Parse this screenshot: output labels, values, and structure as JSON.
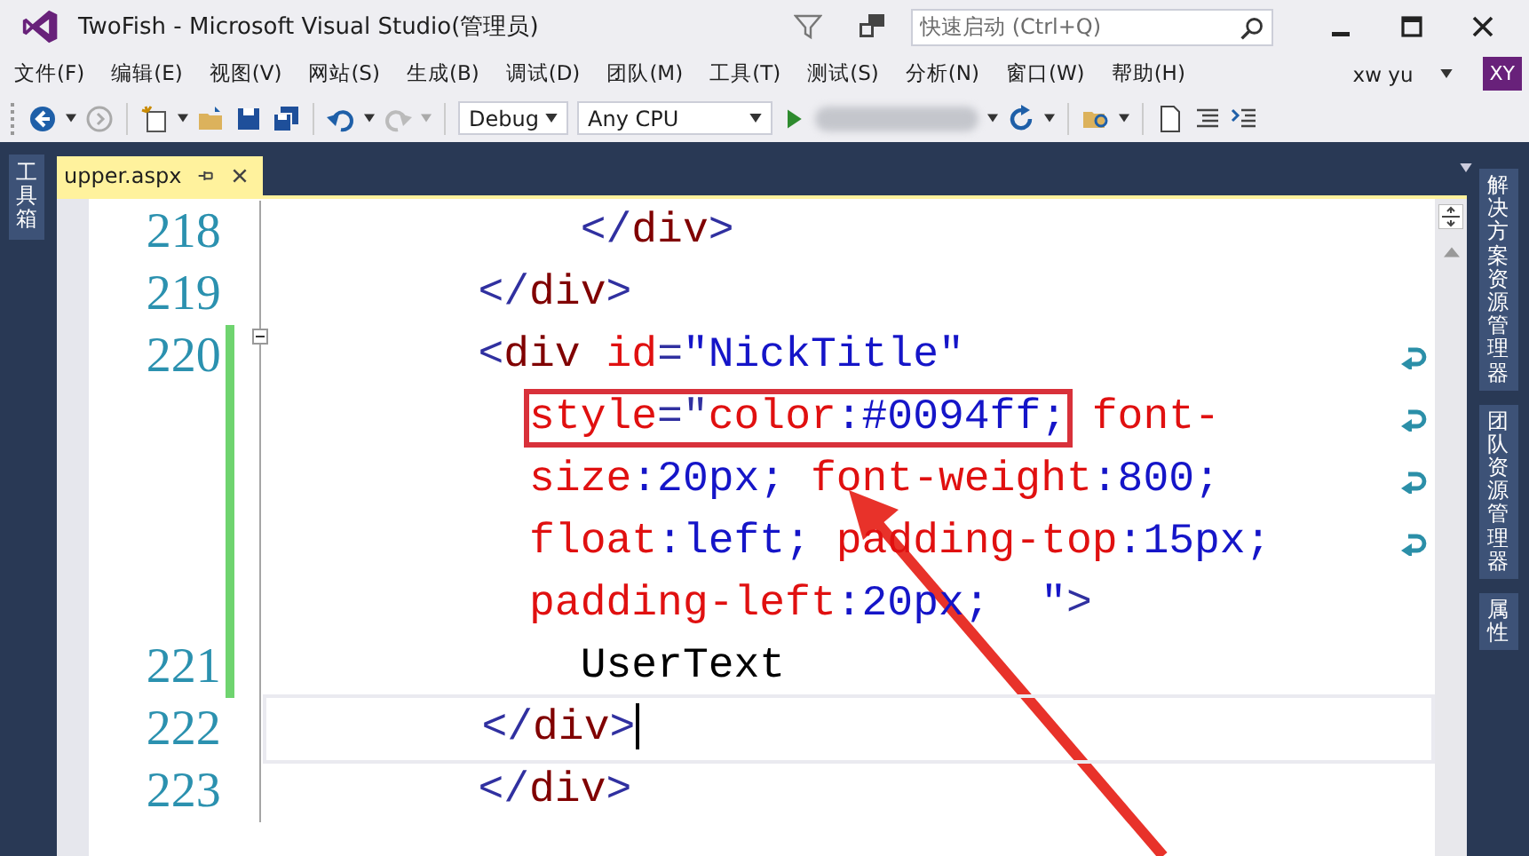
{
  "window": {
    "title": "TwoFish - Microsoft Visual Studio(管理员)"
  },
  "quick_launch": {
    "placeholder": "快速启动 (Ctrl+Q)"
  },
  "menu": [
    "文件(F)",
    "编辑(E)",
    "视图(V)",
    "网站(S)",
    "生成(B)",
    "调试(D)",
    "团队(M)",
    "工具(T)",
    "测试(S)",
    "分析(N)",
    "窗口(W)",
    "帮助(H)"
  ],
  "user": {
    "name": "xw yu",
    "initials": "XY"
  },
  "toolbar": {
    "configuration": "Debug",
    "platform": "Any CPU"
  },
  "left_tabs": [
    "工具箱"
  ],
  "document_tabs": [
    {
      "label": "upper.aspx",
      "selected": true
    }
  ],
  "right_tabs": [
    "解决方案资源管理器",
    "团队资源管理器",
    "属性"
  ],
  "editor": {
    "lines": [
      {
        "number": "218",
        "changed": false,
        "current": false,
        "collapsible": false,
        "visual": [
          {
            "wrapped": false,
            "segments": [
              {
                "kind": "delim",
                "text": "            </"
              },
              {
                "kind": "tag",
                "text": "div"
              },
              {
                "kind": "delim",
                "text": ">"
              }
            ]
          }
        ]
      },
      {
        "number": "219",
        "changed": false,
        "current": false,
        "collapsible": false,
        "visual": [
          {
            "wrapped": false,
            "segments": [
              {
                "kind": "delim",
                "text": "        </"
              },
              {
                "kind": "tag",
                "text": "div"
              },
              {
                "kind": "delim",
                "text": ">"
              }
            ]
          }
        ]
      },
      {
        "number": "220",
        "changed": true,
        "current": false,
        "collapsible": true,
        "visual": [
          {
            "wrapped": true,
            "segments": [
              {
                "kind": "delim",
                "text": "        <"
              },
              {
                "kind": "tag",
                "text": "div"
              },
              {
                "kind": "attr",
                "text": " id"
              },
              {
                "kind": "delim",
                "text": "="
              },
              {
                "kind": "value",
                "text": "\"NickTitle\""
              }
            ]
          },
          {
            "wrapped": true,
            "segments": [
              {
                "kind": "attr",
                "text": "          style",
                "highlighted": true
              },
              {
                "kind": "delim",
                "text": "=\"",
                "highlighted": true
              },
              {
                "kind": "attr",
                "text": "color",
                "highlighted": true
              },
              {
                "kind": "value",
                "text": ":#0094ff;",
                "highlighted": true
              },
              {
                "kind": "attr",
                "text": " font-"
              }
            ]
          },
          {
            "wrapped": true,
            "segments": [
              {
                "kind": "attr",
                "text": "          size"
              },
              {
                "kind": "value",
                "text": ":20px;"
              },
              {
                "kind": "attr",
                "text": " font-weight"
              },
              {
                "kind": "value",
                "text": ":800;"
              }
            ]
          },
          {
            "wrapped": true,
            "segments": [
              {
                "kind": "attr",
                "text": "          float"
              },
              {
                "kind": "value",
                "text": ":left;"
              },
              {
                "kind": "attr",
                "text": " padding-top"
              },
              {
                "kind": "value",
                "text": ":15px;"
              }
            ]
          },
          {
            "wrapped": false,
            "segments": [
              {
                "kind": "attr",
                "text": "          padding-left"
              },
              {
                "kind": "value",
                "text": ":20px;  \""
              },
              {
                "kind": "delim",
                "text": ">"
              }
            ]
          }
        ]
      },
      {
        "number": "221",
        "changed": true,
        "current": false,
        "collapsible": false,
        "visual": [
          {
            "wrapped": false,
            "segments": [
              {
                "kind": "text",
                "text": "            UserText"
              }
            ]
          }
        ]
      },
      {
        "number": "222",
        "changed": false,
        "current": true,
        "collapsible": false,
        "visual": [
          {
            "wrapped": false,
            "segments": [
              {
                "kind": "delim",
                "text": "        </"
              },
              {
                "kind": "tag",
                "text": "div"
              },
              {
                "kind": "delim",
                "text": ">"
              }
            ]
          }
        ]
      },
      {
        "number": "223",
        "changed": false,
        "current": false,
        "collapsible": false,
        "visual": [
          {
            "wrapped": false,
            "segments": [
              {
                "kind": "delim",
                "text": "        </"
              },
              {
                "kind": "tag",
                "text": "div"
              },
              {
                "kind": "delim",
                "text": ">"
              }
            ]
          }
        ]
      }
    ]
  }
}
